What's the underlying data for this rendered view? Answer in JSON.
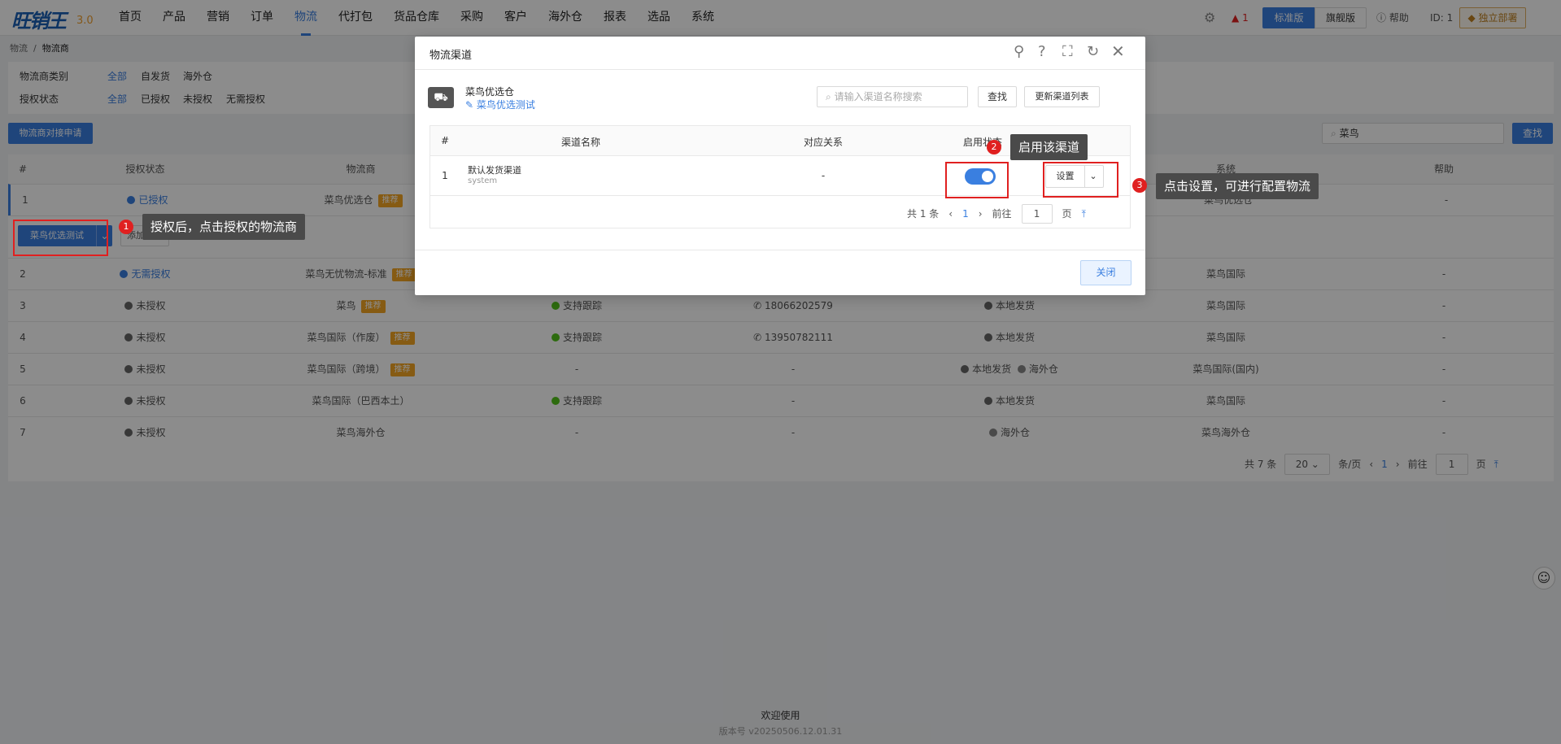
{
  "logo": {
    "brand": "旺销王",
    "version": "3.0"
  },
  "nav": {
    "items": [
      "首页",
      "产品",
      "营销",
      "订单",
      "物流",
      "代打包",
      "货品仓库",
      "采购",
      "客户",
      "海外仓",
      "报表",
      "选品",
      "系统"
    ],
    "active": "物流"
  },
  "topbar": {
    "alert_count": "1",
    "edition_standard": "标准版",
    "edition_flagship": "旗舰版",
    "help": "帮助",
    "id": "ID: 1",
    "independent": "独立部署"
  },
  "breadcrumb": {
    "parent": "物流",
    "current": "物流商"
  },
  "filters": {
    "type_label": "物流商类别",
    "type_options": [
      "全部",
      "自发货",
      "海外仓"
    ],
    "auth_label": "授权状态",
    "auth_options": [
      "全部",
      "已授权",
      "未授权",
      "无需授权"
    ]
  },
  "toolbar": {
    "apply_button": "物流商对接申请",
    "search_value": "菜鸟",
    "search_button": "查找"
  },
  "table": {
    "headers": [
      "#",
      "授权状态",
      "物流商",
      "",
      "",
      "",
      "系统",
      "帮助"
    ],
    "rows": [
      {
        "n": "1",
        "status": "已授权",
        "provider": "菜鸟优选仓",
        "rec": "推荐",
        "track": "",
        "phone": "",
        "ship": "",
        "ship2": "",
        "system": "菜鸟优选仓",
        "help": "-"
      },
      {
        "n": "2",
        "status": "无需授权",
        "provider": "菜鸟无忧物流-标准",
        "rec": "推荐",
        "track": "",
        "phone": "",
        "ship": "",
        "ship2": "",
        "system": "菜鸟国际",
        "help": "-"
      },
      {
        "n": "3",
        "status": "未授权",
        "provider": "菜鸟",
        "rec": "推荐",
        "track": "支持跟踪",
        "phone": "18066202579",
        "ship": "本地发货",
        "ship2": "",
        "system": "菜鸟国际",
        "help": "-"
      },
      {
        "n": "4",
        "status": "未授权",
        "provider": "菜鸟国际（作废）",
        "rec": "推荐",
        "track": "支持跟踪",
        "phone": "13950782111",
        "ship": "本地发货",
        "ship2": "",
        "system": "菜鸟国际",
        "help": "-"
      },
      {
        "n": "5",
        "status": "未授权",
        "provider": "菜鸟国际（跨境）",
        "rec": "推荐",
        "track": "-",
        "phone": "-",
        "ship": "本地发货",
        "ship2": "海外仓",
        "system": "菜鸟国际(国内)",
        "help": "-"
      },
      {
        "n": "6",
        "status": "未授权",
        "provider": "菜鸟国际（巴西本土）",
        "rec": "",
        "track": "支持跟踪",
        "phone": "-",
        "ship": "本地发货",
        "ship2": "",
        "system": "菜鸟国际",
        "help": "-"
      },
      {
        "n": "7",
        "status": "未授权",
        "provider": "菜鸟海外仓",
        "rec": "",
        "track": "-",
        "phone": "-",
        "ship": "",
        "ship2": "海外仓",
        "system": "菜鸟海外仓",
        "help": "-"
      }
    ],
    "row1_action": "菜鸟优选测试",
    "row1_second": "添加授权"
  },
  "pagination": {
    "total": "共 7 条",
    "per_page": "20",
    "per_page_unit": "条/页",
    "page": "1",
    "goto": "前往",
    "goto_value": "1",
    "page_unit": "页"
  },
  "footer": {
    "welcome": "欢迎使用",
    "version": "版本号 v20250506.12.01.31"
  },
  "modal": {
    "title": "物流渠道",
    "warehouse_name": "菜鸟优选仓",
    "warehouse_link": "菜鸟优选测试",
    "search_placeholder": "请输入渠道名称搜索",
    "search_button": "查找",
    "refresh_button": "更新渠道列表",
    "headers": [
      "#",
      "渠道名称",
      "对应关系",
      "启用状态",
      "操作"
    ],
    "row": {
      "n": "1",
      "channel": "默认发货渠道",
      "sub": "system",
      "mapping": "-",
      "setting": "设置"
    },
    "pagination": {
      "total": "共 1 条",
      "page": "1",
      "goto": "前往",
      "goto_value": "1",
      "page_unit": "页"
    },
    "close_button": "关闭"
  },
  "callouts": {
    "c1": {
      "num": "1",
      "text": "授权后，点击授权的物流商"
    },
    "c2": {
      "num": "2",
      "text": "启用该渠道"
    },
    "c3": {
      "num": "3",
      "text": "点击设置，可进行配置物流"
    }
  },
  "colors": {
    "accent": "#3a7fe0",
    "recommend": "#f5a623",
    "success": "#52c41a",
    "callout_red": "#e02020"
  }
}
